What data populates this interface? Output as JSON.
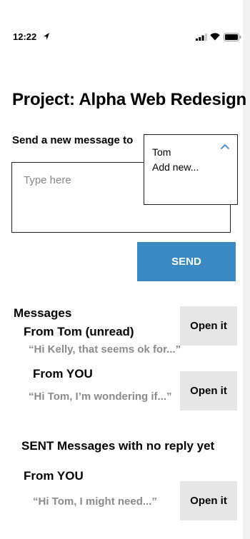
{
  "status_bar": {
    "time": "12:22",
    "icons": [
      "location-arrow-icon",
      "signal-icon",
      "wifi-icon",
      "battery-icon"
    ]
  },
  "page": {
    "title": "Project: Alpha Web Redesign"
  },
  "compose": {
    "label": "Send a new message to",
    "placeholder": "Type here",
    "recipient_options": [
      "Tom",
      "Add new..."
    ],
    "send_label": "SEND"
  },
  "messages": {
    "heading": "Messages",
    "items": [
      {
        "from": "From Tom (unread)",
        "preview": "“Hi Kelly, that seems ok for...”",
        "action": "Open it"
      },
      {
        "from": "From YOU",
        "preview": "“Hi Tom, I’m wondering if...”",
        "action": "Open it"
      }
    ]
  },
  "sent": {
    "heading": "SENT Messages with no reply yet",
    "items": [
      {
        "from": "From YOU",
        "preview": "“Hi Tom, I might need...”",
        "action": "Open it"
      }
    ]
  },
  "colors": {
    "accent": "#3b8ac4",
    "button_secondary": "#e4e6e8",
    "muted_text": "#8c8c8c"
  }
}
